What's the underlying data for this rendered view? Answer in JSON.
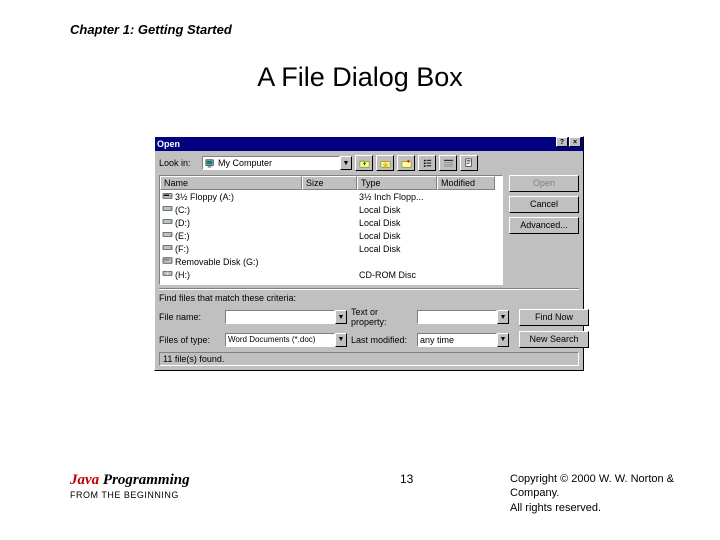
{
  "chapter": "Chapter 1: Getting Started",
  "slide_title": "A File Dialog Box",
  "dialog": {
    "title": "Open",
    "help_btn": "?",
    "close_btn": "×",
    "look_in_label": "Look in:",
    "look_in_value": "My Computer",
    "columns": {
      "name": "Name",
      "size": "Size",
      "type": "Type",
      "modified": "Modified"
    },
    "files": [
      {
        "name": "3½ Floppy (A:)",
        "type": "3½ Inch Flopp...",
        "icon": "floppy"
      },
      {
        "name": "(C:)",
        "type": "Local Disk",
        "icon": "hdd"
      },
      {
        "name": "(D:)",
        "type": "Local Disk",
        "icon": "hdd"
      },
      {
        "name": "(E:)",
        "type": "Local Disk",
        "icon": "hdd"
      },
      {
        "name": "(F:)",
        "type": "Local Disk",
        "icon": "hdd"
      },
      {
        "name": "Removable Disk (G:)",
        "type": "",
        "icon": "removable"
      },
      {
        "name": "(H:)",
        "type": "CD-ROM Disc",
        "icon": "cdrom"
      }
    ],
    "buttons": {
      "open": "Open",
      "cancel": "Cancel",
      "advanced": "Advanced..."
    },
    "criteria_label": "Find files that match these criteria:",
    "file_name_label": "File name:",
    "file_name_value": "",
    "text_or_prop_label": "Text or property:",
    "text_or_prop_value": "",
    "files_of_type_label": "Files of type:",
    "files_of_type_value": "Word Documents (*.doc)",
    "last_modified_label": "Last modified:",
    "last_modified_value": "any time",
    "find_now": "Find Now",
    "new_search": "New Search",
    "status": "11 file(s) found."
  },
  "footer": {
    "book_java": "Java",
    "book_rest": " Programming",
    "book_sub": "FROM THE BEGINNING",
    "page": "13",
    "copyright1": "Copyright © 2000 W. W. Norton & Company.",
    "copyright2": "All rights reserved."
  }
}
